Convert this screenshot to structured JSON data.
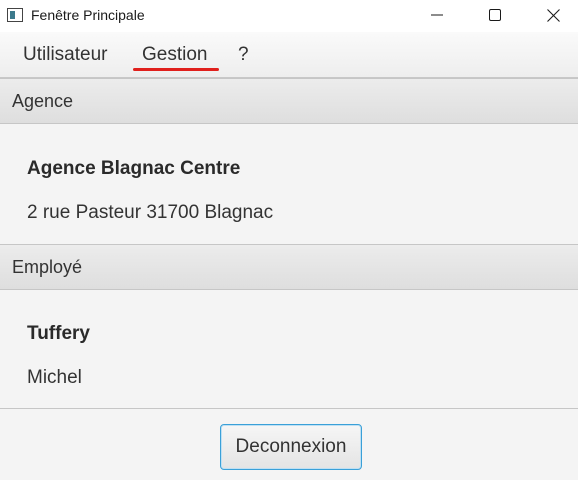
{
  "window": {
    "title": "Fenêtre Principale",
    "controls": {
      "minimize": "minimize-icon",
      "maximize": "maximize-icon",
      "close": "close-icon"
    }
  },
  "menu": {
    "items": [
      {
        "label": "Utilisateur"
      },
      {
        "label": "Gestion",
        "underline_color": "#e0201c"
      },
      {
        "label": "?"
      }
    ]
  },
  "agence": {
    "header": "Agence",
    "name": "Agence Blagnac Centre",
    "address": "2 rue Pasteur 31700 Blagnac"
  },
  "employe": {
    "header": "Employé",
    "nom": "Tuffery",
    "prenom": "Michel"
  },
  "actions": {
    "deconnexion_label": "Deconnexion"
  },
  "colors": {
    "focus_border": "#3aa0d8",
    "background": "#f4f4f4"
  }
}
